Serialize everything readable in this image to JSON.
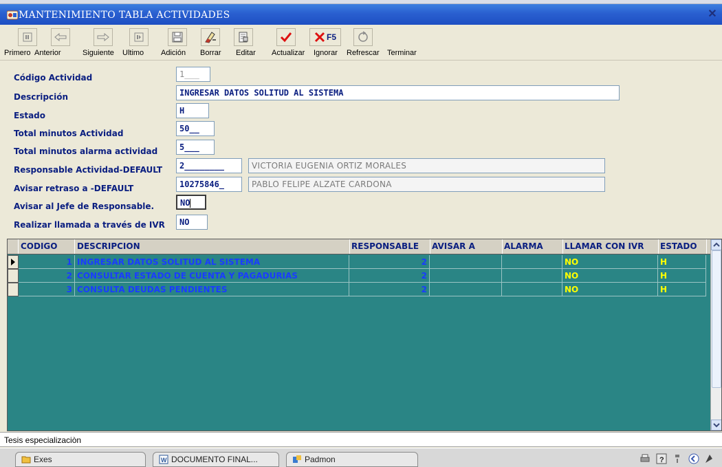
{
  "window": {
    "title": "MANTENIMIENTO TABLA ACTIVIDADES",
    "close_icon": "close-x-icon"
  },
  "toolbar": {
    "buttons": [
      {
        "label": "Primero",
        "icon": "first-record-icon"
      },
      {
        "label": "Anterior",
        "icon": "previous-record-icon"
      },
      {
        "label": "Siguiente",
        "icon": "next-record-icon"
      },
      {
        "label": "Ultimo",
        "icon": "last-record-icon"
      },
      {
        "label": "Adición",
        "icon": "floppy-add-icon"
      },
      {
        "label": "Borrar",
        "icon": "eraser-delete-icon"
      },
      {
        "label": "Editar",
        "icon": "edit-document-icon"
      },
      {
        "label": "Actualizar",
        "icon": "check-update-icon"
      },
      {
        "label": "Ignorar",
        "icon": "x-ignore-icon"
      },
      {
        "label": "Refrescar",
        "icon": "refresh-icon"
      },
      {
        "label": "Terminar",
        "icon": "terminate-icon"
      }
    ],
    "f5_label": "F5"
  },
  "form": {
    "codigo": {
      "label": "Código Actividad",
      "value": "1___"
    },
    "descripcion": {
      "label": "Descripción",
      "value": "INGRESAR DATOS SOLITUD AL SISTEMA"
    },
    "estado": {
      "label": "Estado",
      "value": "H"
    },
    "total_minutos": {
      "label": "Total minutos Actividad",
      "value": "50__"
    },
    "total_alarma": {
      "label": "Total minutos alarma actividad",
      "value": "5___"
    },
    "responsable": {
      "label": "Responsable Actividad-DEFAULT",
      "value": "2________",
      "name": "VICTORIA EUGENIA ORTIZ MORALES"
    },
    "avisar_retraso": {
      "label": "Avisar retraso a -DEFAULT",
      "value": "10275846_",
      "name": "PABLO FELIPE ALZATE CARDONA"
    },
    "avisar_jefe": {
      "label": "Avisar al Jefe de Responsable.",
      "value": "NO"
    },
    "llamada_ivr": {
      "label": "Realizar llamada a través de IVR",
      "value": "NO"
    }
  },
  "grid": {
    "columns": [
      "CODIGO",
      "DESCRIPCION",
      "RESPONSABLE",
      "AVISAR A",
      "ALARMA",
      "LLAMAR CON IVR",
      "ESTADO"
    ],
    "rows": [
      {
        "codigo": "1",
        "descripcion": "INGRESAR DATOS SOLITUD AL SISTEMA",
        "responsable": "2",
        "avisar_a": "",
        "alarma": "",
        "ivr": "NO",
        "estado": "H"
      },
      {
        "codigo": "2",
        "descripcion": "CONSULTAR ESTADO DE CUENTA Y PAGADURIAS",
        "responsable": "2",
        "avisar_a": "",
        "alarma": "",
        "ivr": "NO",
        "estado": "H"
      },
      {
        "codigo": "3",
        "descripcion": "CONSULTA DEUDAS PENDIENTES",
        "responsable": "2",
        "avisar_a": "",
        "alarma": "",
        "ivr": "NO",
        "estado": "H"
      }
    ]
  },
  "status": {
    "text": "Tesis especializaciòn"
  },
  "taskbar": {
    "tasks": [
      {
        "label": "Exes",
        "icon": "folder-icon"
      },
      {
        "label": "DOCUMENTO FINAL...",
        "icon": "word-document-icon"
      },
      {
        "label": "Padmon",
        "icon": "padmon-app-icon"
      }
    ]
  },
  "colors": {
    "title_bar": "#2a5fd0",
    "grid_bg": "#2a8585",
    "label_text": "#0a1e80",
    "grid_text_blue": "#1a3cff",
    "grid_text_yellow": "#ffff00"
  }
}
